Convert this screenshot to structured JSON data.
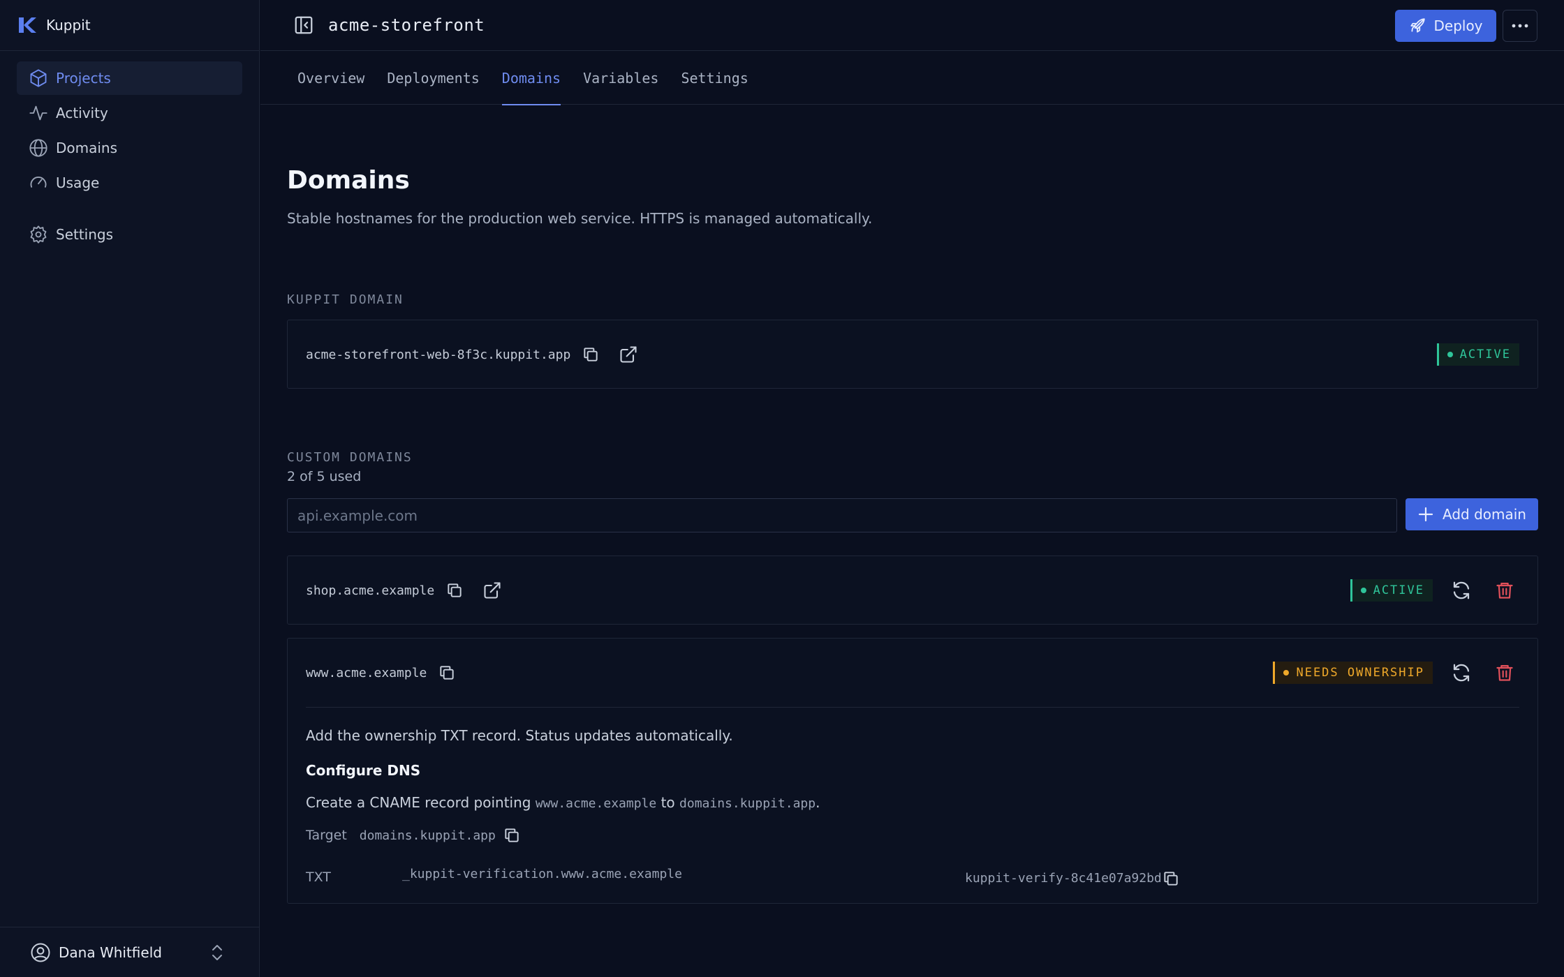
{
  "brand": {
    "name": "Kuppit"
  },
  "sidebar": {
    "items": [
      {
        "label": "Projects",
        "icon": "cube-icon",
        "active": true
      },
      {
        "label": "Activity",
        "icon": "activity-icon",
        "active": false
      },
      {
        "label": "Domains",
        "icon": "globe-icon",
        "active": false
      },
      {
        "label": "Usage",
        "icon": "gauge-icon",
        "active": false
      },
      {
        "label": "Settings",
        "icon": "gear-icon",
        "active": false
      }
    ],
    "user": {
      "name": "Dana Whitfield"
    }
  },
  "header": {
    "project": "acme-storefront",
    "deploy_label": "Deploy"
  },
  "tabs": [
    {
      "label": "Overview",
      "active": false
    },
    {
      "label": "Deployments",
      "active": false
    },
    {
      "label": "Domains",
      "active": true
    },
    {
      "label": "Variables",
      "active": false
    },
    {
      "label": "Settings",
      "active": false
    }
  ],
  "page": {
    "title": "Domains",
    "subtitle": "Stable hostnames for the production web service. HTTPS is managed automatically."
  },
  "kuppit_domain": {
    "label": "KUPPIT DOMAIN",
    "hostname": "acme-storefront-web-8f3c.kuppit.app",
    "status": "ACTIVE"
  },
  "custom_domains": {
    "label": "CUSTOM DOMAINS",
    "usage": "2 of 5 used",
    "input_placeholder": "api.example.com",
    "add_label": "Add domain",
    "items": [
      {
        "hostname": "shop.acme.example",
        "status": "ACTIVE"
      },
      {
        "hostname": "www.acme.example",
        "status": "NEEDS OWNERSHIP"
      }
    ]
  },
  "dns": {
    "note": "Add the ownership TXT record. Status updates automatically.",
    "heading": "Configure DNS",
    "cname_prefix": "Create a CNAME record pointing",
    "cname_source": "www.acme.example",
    "cname_to": "to",
    "cname_target": "domains.kuppit.app",
    "cname_suffix": ".",
    "target_label": "Target",
    "target_value": "domains.kuppit.app",
    "txt_label": "TXT",
    "txt_name": "_kuppit-verification.www.acme.example",
    "txt_value": "kuppit-verify-8c41e07a92bd"
  },
  "colors": {
    "accent": "#3d63dd",
    "active": "#2fc59a",
    "warning": "#f0a92a",
    "danger": "#e0505a"
  }
}
